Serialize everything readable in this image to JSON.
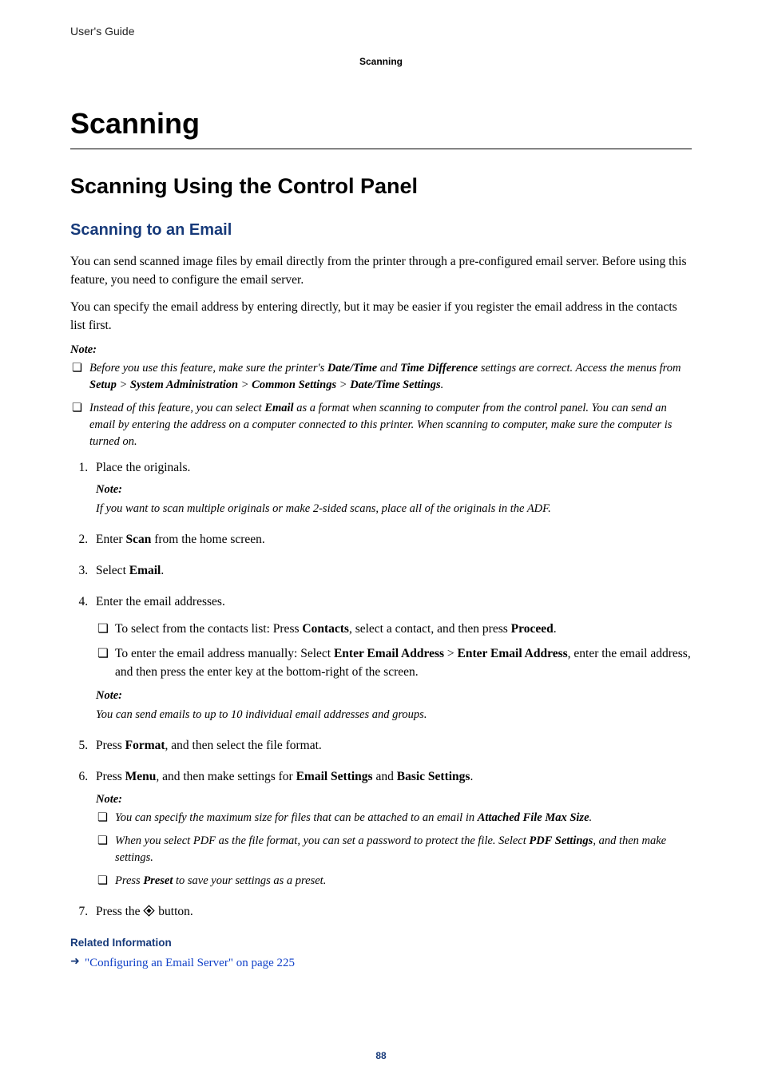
{
  "header": {
    "doc_title": "User's Guide",
    "section": "Scanning"
  },
  "chapter_title": "Scanning",
  "section_title": "Scanning Using the Control Panel",
  "subsection_title": "Scanning to an Email",
  "intro_p1": "You can send scanned image files by email directly from the printer through a pre-configured email server. Before using this feature, you need to configure the email server.",
  "intro_p2": "You can specify the email address by entering directly, but it may be easier if you register the email address in the contacts list first.",
  "note_label": "Note:",
  "note1": {
    "item1": {
      "pre": "Before you use this feature, make sure the printer's ",
      "b1": "Date/Time",
      "mid1": " and ",
      "b2": "Time Difference",
      "mid2": " settings are correct. Access the menus from ",
      "b3": "Setup",
      "gt1": " > ",
      "b4": "System Administration",
      "gt2": " > ",
      "b5": "Common Settings",
      "gt3": " > ",
      "b6": "Date/Time Settings",
      "post": "."
    },
    "item2": {
      "pre": "Instead of this feature, you can select ",
      "b1": "Email",
      "post": " as a format when scanning to computer from the control panel. You can send an email by entering the address on a computer connected to this printer. When scanning to computer, make sure the computer is turned on."
    }
  },
  "steps": {
    "s1": {
      "text": "Place the originals.",
      "note": "If you want to scan multiple originals or make 2-sided scans, place all of the originals in the ADF."
    },
    "s2": {
      "pre": "Enter ",
      "b1": "Scan",
      "post": " from the home screen."
    },
    "s3": {
      "pre": "Select ",
      "b1": "Email",
      "post": "."
    },
    "s4": {
      "text": "Enter the email addresses.",
      "sub1": {
        "pre": "To select from the contacts list: Press ",
        "b1": "Contacts",
        "mid": ", select a contact, and then press ",
        "b2": "Proceed",
        "post": "."
      },
      "sub2": {
        "pre": "To enter the email address manually: Select ",
        "b1": "Enter Email Address",
        "gt": " > ",
        "b2": "Enter Email Address",
        "post": ", enter the email address, and then press the enter key at the bottom-right of the screen."
      },
      "note": "You can send emails to up to 10 individual email addresses and groups."
    },
    "s5": {
      "pre": "Press ",
      "b1": "Format",
      "post": ", and then select the file format."
    },
    "s6": {
      "pre": "Press ",
      "b1": "Menu",
      "mid": ", and then make settings for ",
      "b2": "Email Settings",
      "and": " and ",
      "b3": "Basic Settings",
      "post": ".",
      "n1": {
        "pre": "You can specify the maximum size for files that can be attached to an email in ",
        "b1": "Attached File Max Size",
        "post": "."
      },
      "n2": {
        "pre": "When you select PDF as the file format, you can set a password to protect the file. Select ",
        "b1": "PDF Settings",
        "post": ", and then make settings."
      },
      "n3": {
        "pre": "Press ",
        "b1": "Preset",
        "post": " to save your settings as a preset."
      }
    },
    "s7": {
      "pre": "Press the ",
      "post": " button."
    }
  },
  "related": {
    "heading": "Related Information",
    "link1": "\"Configuring an Email Server\" on page 225"
  },
  "page_number": "88"
}
